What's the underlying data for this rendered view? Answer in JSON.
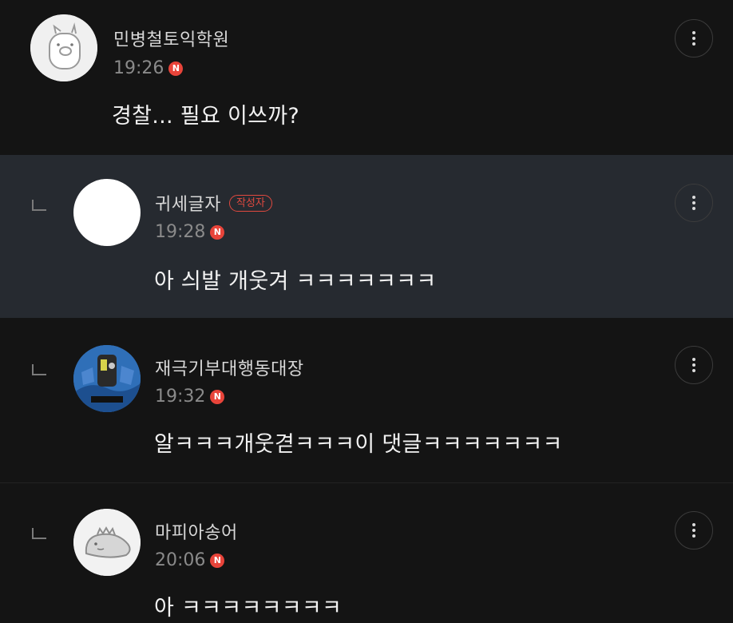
{
  "comments": [
    {
      "nickname": "민병철토익학원",
      "time": "19:26",
      "new_badge": "N",
      "text": "경찰... 필요 이쓰까?",
      "is_reply": false,
      "is_author": false,
      "avatar": "pig-sticker-avatar"
    },
    {
      "nickname": "귀세글자",
      "author_badge": "작성자",
      "time": "19:28",
      "new_badge": "N",
      "text": "아 싀발 개웃겨 ㅋㅋㅋㅋㅋㅋㅋ",
      "is_reply": true,
      "is_author": true,
      "avatar": "blank-white-avatar"
    },
    {
      "nickname": "재극기부대행동대장",
      "time": "19:32",
      "new_badge": "N",
      "text": "알ㅋㅋㅋ개웃겯ㅋㅋㅋ이 댓글ㅋㅋㅋㅋㅋㅋㅋ",
      "is_reply": true,
      "is_author": false,
      "avatar": "photo-avatar"
    },
    {
      "nickname": "마피아송어",
      "time": "20:06",
      "new_badge": "N",
      "text": "아 ㅋㅋㅋㅋㅋㅋㅋㅋ",
      "is_reply": true,
      "is_author": false,
      "avatar": "dinosaur-sticker-avatar"
    }
  ],
  "colors": {
    "background": "#141414",
    "highlight_background": "#262a30",
    "new_badge": "#e8443a",
    "author_badge": "#e0493f"
  },
  "icons": {
    "more": "vertical-ellipsis-icon",
    "reply": "reply-arrow-icon",
    "new": "new-badge-icon"
  }
}
